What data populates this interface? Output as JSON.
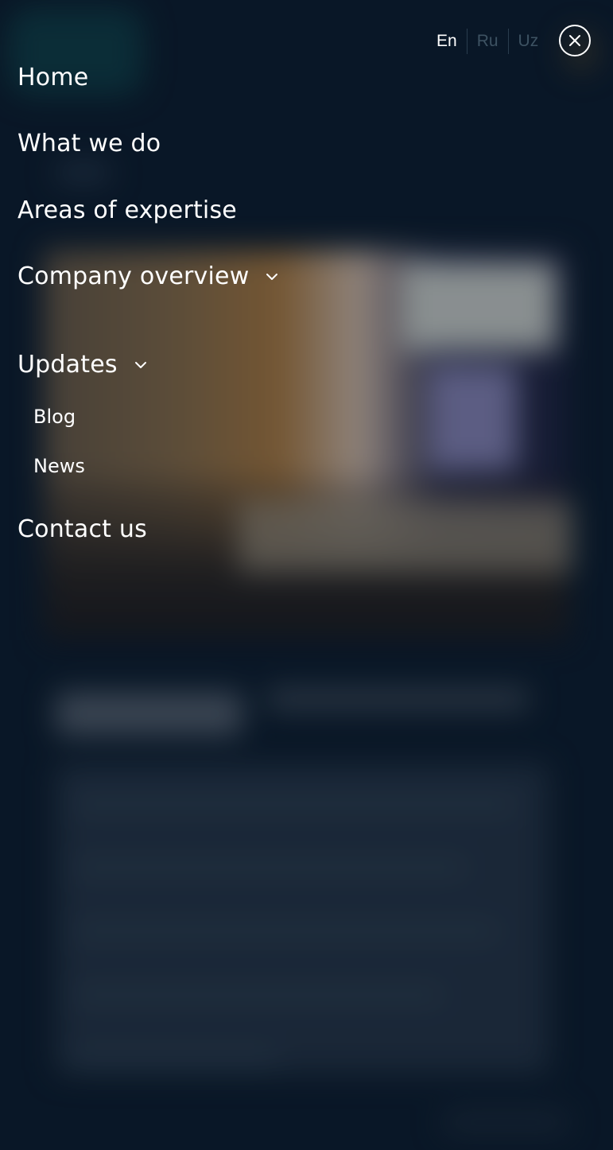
{
  "languages": [
    {
      "code": "En",
      "active": true
    },
    {
      "code": "Ru",
      "active": false
    },
    {
      "code": "Uz",
      "active": false
    }
  ],
  "menu": {
    "home": "Home",
    "what_we_do": "What we do",
    "areas_of_expertise": "Areas of expertise",
    "company_overview": "Company overview",
    "updates": "Updates",
    "updates_sub": {
      "blog": "Blog",
      "news": "News"
    },
    "contact_us": "Contact us"
  },
  "icons": {
    "close": "close-icon",
    "dropdown": "chevron-down-icon"
  },
  "colors": {
    "background": "#0c1b2b",
    "text": "#ffffff",
    "inactive_lang": "#3d5262"
  }
}
